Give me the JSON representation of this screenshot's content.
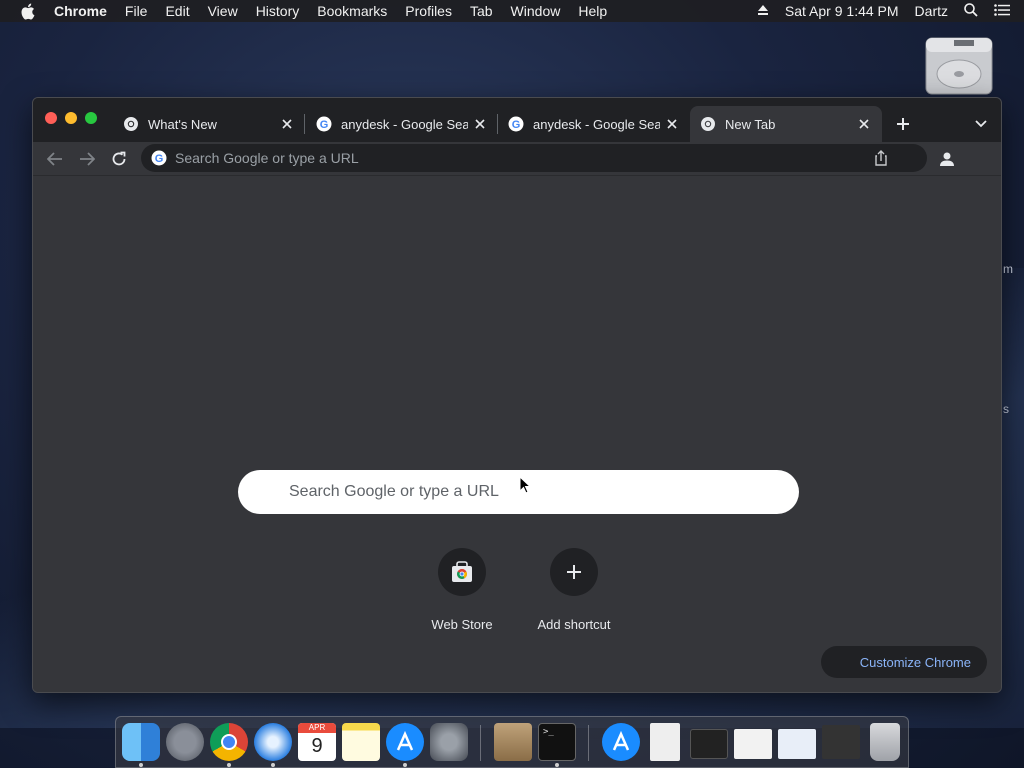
{
  "menubar": {
    "app_name": "Chrome",
    "items": [
      "File",
      "Edit",
      "View",
      "History",
      "Bookmarks",
      "Profiles",
      "Tab",
      "Window",
      "Help"
    ],
    "datetime": "Sat Apr 9  1:44 PM",
    "user": "Dartz"
  },
  "tabs": [
    {
      "title": "What's New",
      "active": false
    },
    {
      "title": "anydesk - Google Search",
      "active": false
    },
    {
      "title": "anydesk - Google Search",
      "active": false
    },
    {
      "title": "New Tab",
      "active": true
    }
  ],
  "toolbar": {
    "omnibox_placeholder": "Search Google or type a URL"
  },
  "ntp": {
    "search_placeholder": "Search Google or type a URL",
    "shortcuts": [
      {
        "label": "Web Store",
        "icon": "web-store-icon"
      },
      {
        "label": "Add shortcut",
        "icon": "plus-icon"
      }
    ],
    "customize_label": "Customize Chrome"
  },
  "dock": {
    "items": [
      "finder",
      "launchpad",
      "chrome",
      "safari",
      "calendar",
      "notes",
      "app-store",
      "system-preferences",
      "archive-utility",
      "terminal",
      "app-store-downloads",
      "document",
      "screen-preview",
      "window-preview-1",
      "window-preview-2",
      "window-preview-3",
      "trash"
    ],
    "calendar_month": "APR",
    "calendar_day": "9"
  },
  "edge_labels": {
    "m": "m",
    "s": "s"
  },
  "colors": {
    "accent": "#8ab4f8",
    "tabstrip": "#202124",
    "content": "#35363a"
  }
}
